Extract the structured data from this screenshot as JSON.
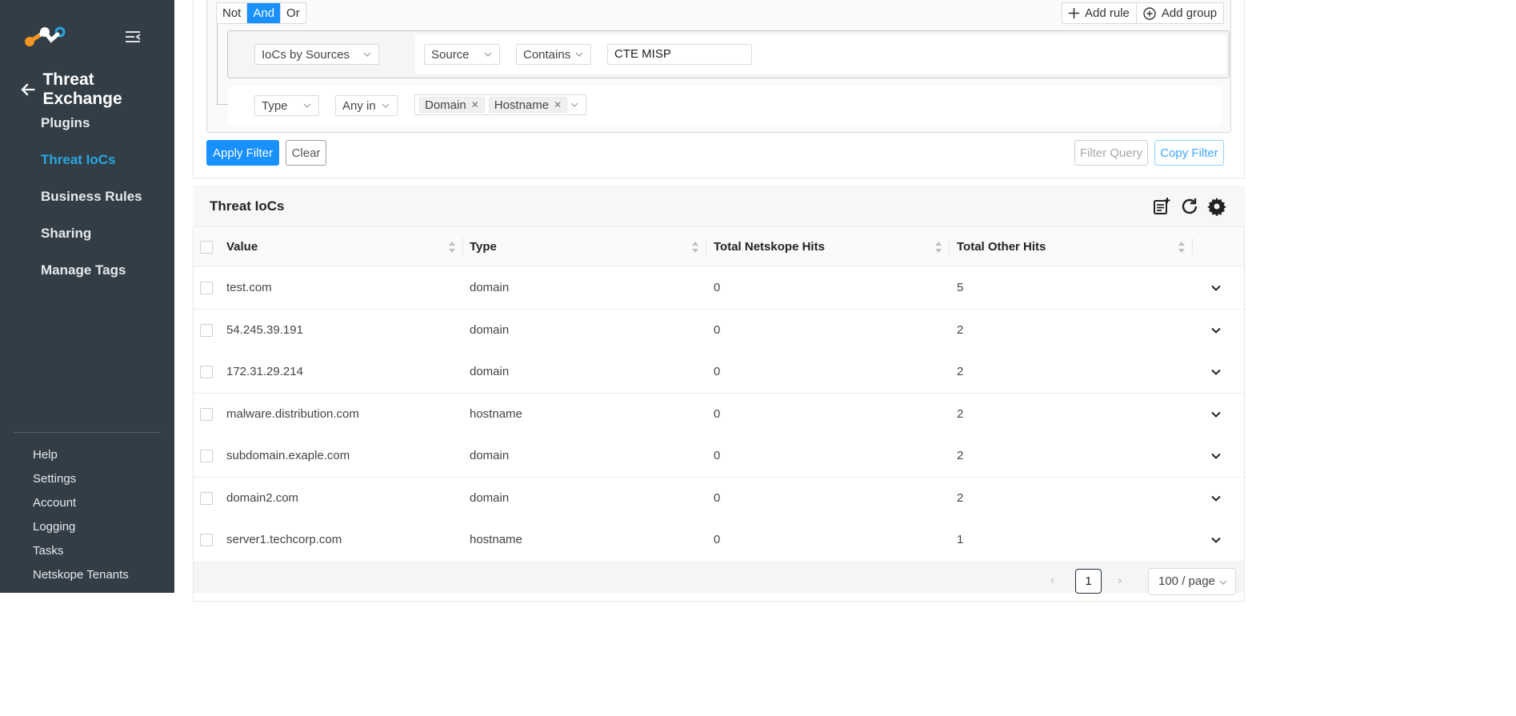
{
  "sidebar": {
    "module_title": "Threat Exchange",
    "nav": [
      {
        "label": "Plugins",
        "active": false
      },
      {
        "label": "Threat IoCs",
        "active": true
      },
      {
        "label": "Business Rules",
        "active": false
      },
      {
        "label": "Sharing",
        "active": false
      },
      {
        "label": "Manage Tags",
        "active": false
      }
    ],
    "sub_nav": [
      "Help",
      "Settings",
      "Account",
      "Logging",
      "Tasks",
      "Netskope Tenants"
    ]
  },
  "filter": {
    "logic": [
      "Not",
      "And",
      "Or"
    ],
    "logic_active": "And",
    "add_rule": "Add rule",
    "add_group": "Add group",
    "group_field": "IoCs by Sources",
    "rule1": {
      "field": "Source",
      "operator": "Contains",
      "value": "CTE MISP"
    },
    "rule2": {
      "field": "Type",
      "operator": "Any in",
      "tags": [
        "Domain",
        "Hostname"
      ]
    },
    "apply": "Apply Filter",
    "clear": "Clear",
    "filter_query": "Filter Query",
    "copy_filter": "Copy Filter"
  },
  "table": {
    "title": "Threat IoCs",
    "columns": [
      "Value",
      "Type",
      "Total Netskope Hits",
      "Total Other Hits"
    ],
    "rows": [
      {
        "value": "test.com",
        "type": "domain",
        "netskope_hits": "0",
        "other_hits": "5"
      },
      {
        "value": "54.245.39.191",
        "type": "domain",
        "netskope_hits": "0",
        "other_hits": "2"
      },
      {
        "value": "172.31.29.214",
        "type": "domain",
        "netskope_hits": "0",
        "other_hits": "2"
      },
      {
        "value": "malware.distribution.com",
        "type": "hostname",
        "netskope_hits": "0",
        "other_hits": "2"
      },
      {
        "value": "subdomain.exaple.com",
        "type": "domain",
        "netskope_hits": "0",
        "other_hits": "2"
      },
      {
        "value": "domain2.com",
        "type": "domain",
        "netskope_hits": "0",
        "other_hits": "2"
      },
      {
        "value": "server1.techcorp.com",
        "type": "hostname",
        "netskope_hits": "0",
        "other_hits": "1"
      }
    ]
  },
  "pagination": {
    "current": "1",
    "page_size": "100 / page"
  },
  "colors": {
    "sidebar": "#323d46",
    "accent": "#1890ff",
    "active_nav": "#2aa8e0"
  }
}
